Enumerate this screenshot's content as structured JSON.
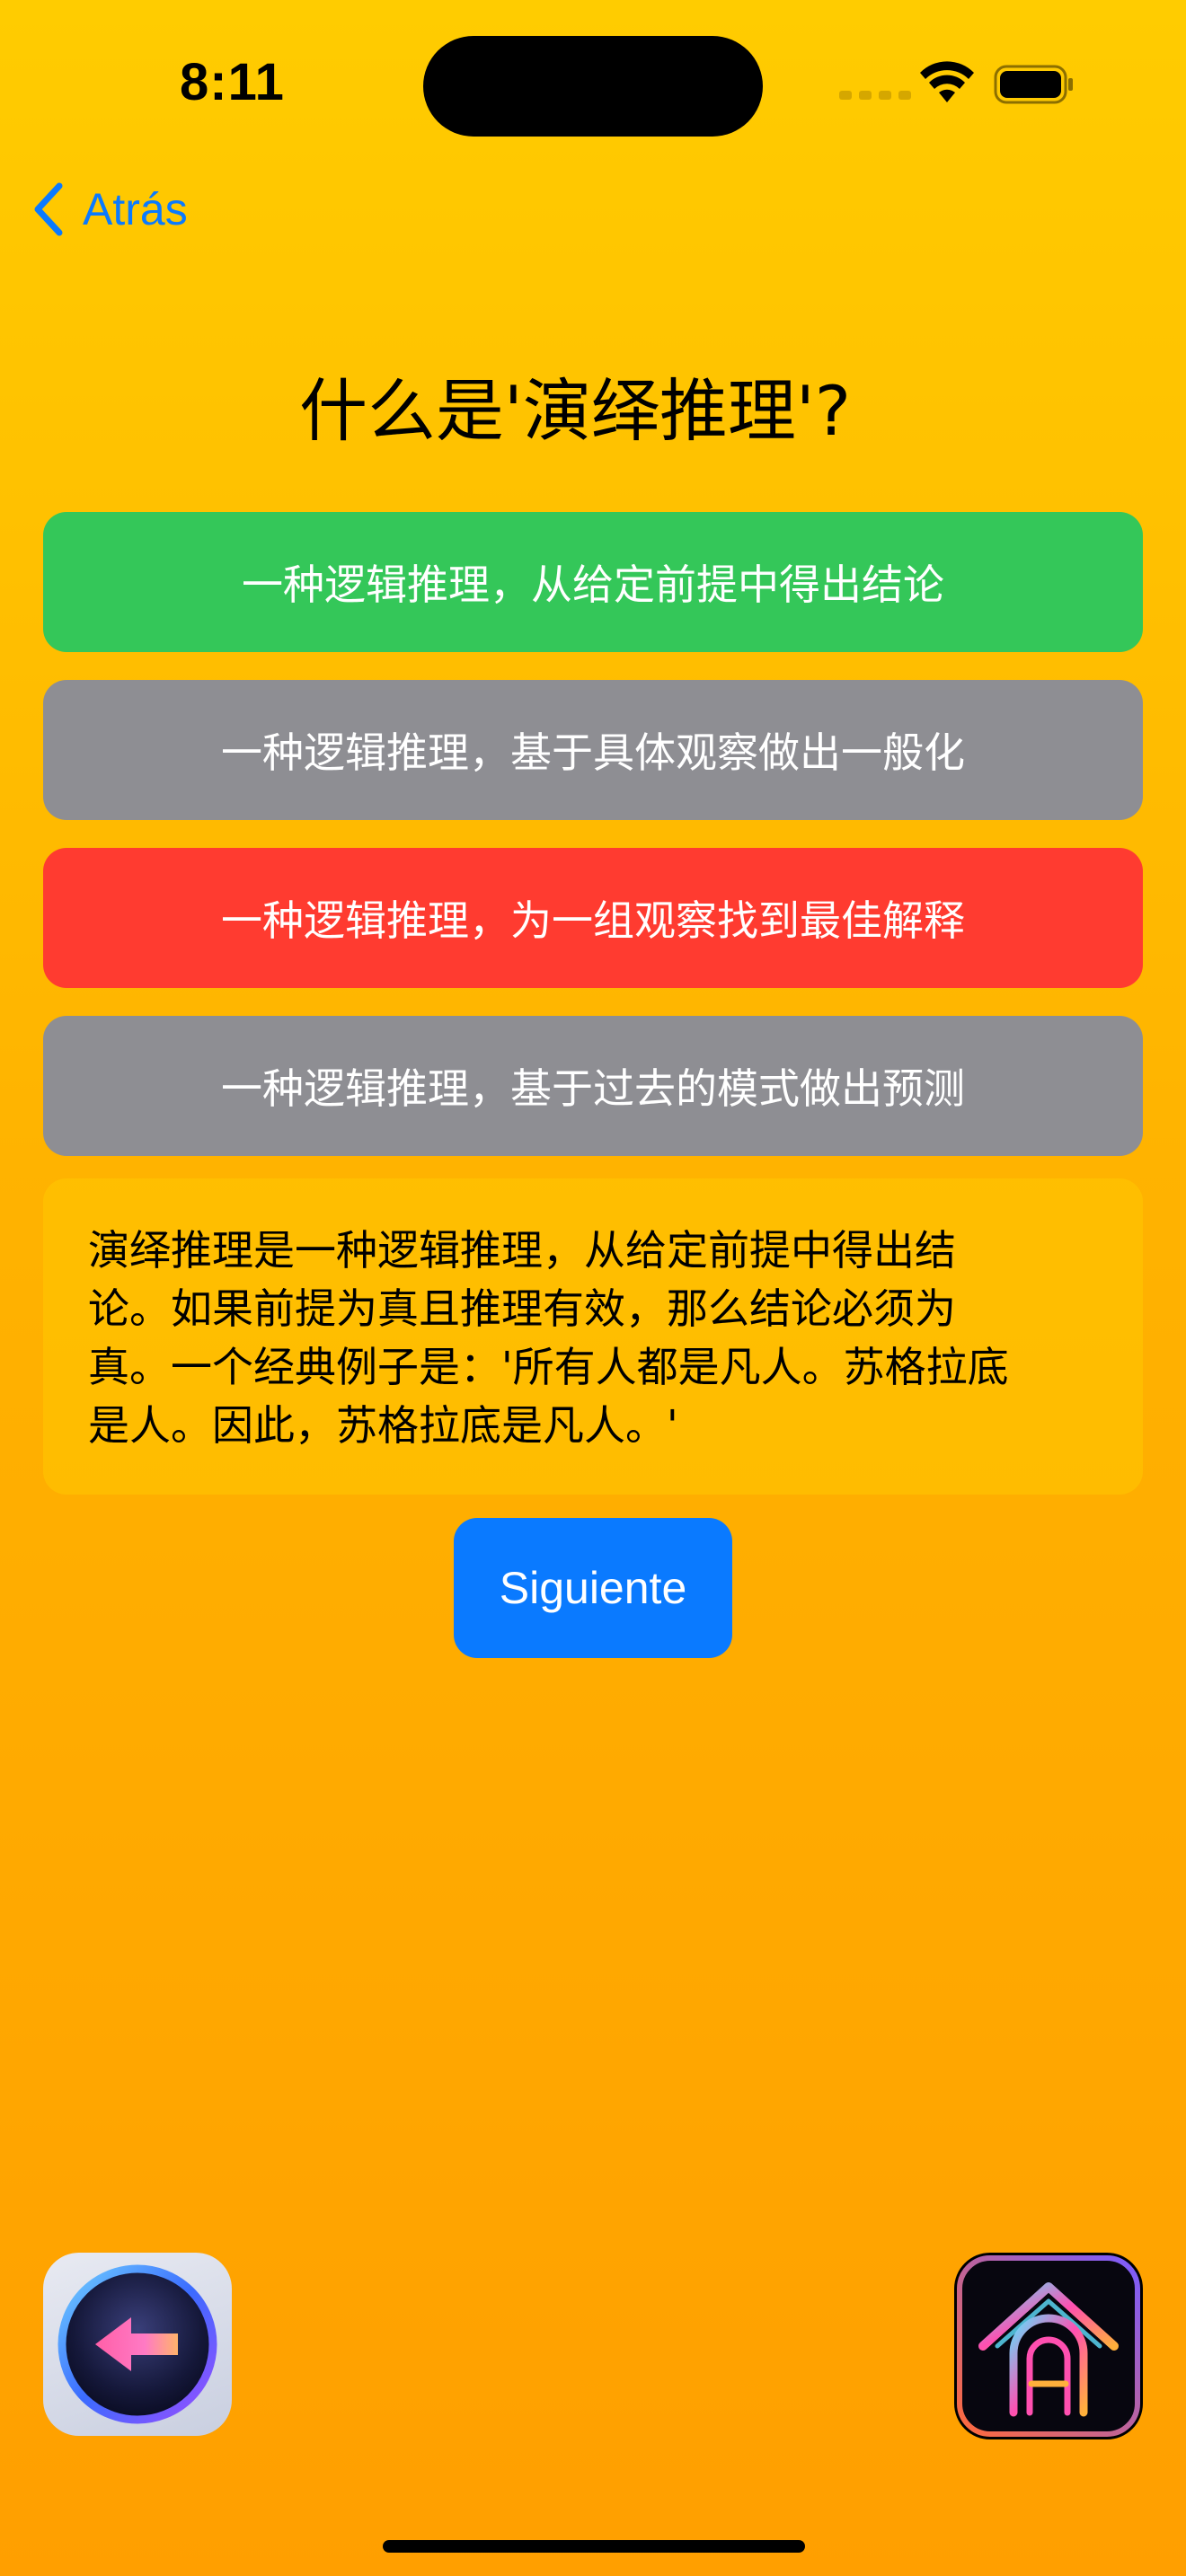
{
  "status_bar": {
    "time": "8:11"
  },
  "nav": {
    "back_label": "Atrás",
    "back_icon": "chevron-left-icon"
  },
  "question": {
    "title": "什么是'演绎推理'?"
  },
  "options": [
    {
      "label": "一种逻辑推理，从给定前提中得出结论",
      "state": "correct",
      "color": "#34C759"
    },
    {
      "label": "一种逻辑推理，基于具体观察做出一般化",
      "state": "neutral",
      "color": "#8E8E93"
    },
    {
      "label": "一种逻辑推理，为一组观察找到最佳解释",
      "state": "wrong",
      "color": "#FF3B30"
    },
    {
      "label": "一种逻辑推理，基于过去的模式做出预测",
      "state": "neutral",
      "color": "#8E8E93"
    }
  ],
  "explanation": {
    "lines": [
      "演绎推理是一种逻辑推理，从给定前提中得出结",
      "论。如果前提为真且推理有效，那么结论必须为",
      "真。一个经典例子是：'所有人都是凡人。苏格拉底",
      "是人。因此，苏格拉底是凡人。'"
    ]
  },
  "next_button": {
    "label": "Siguiente",
    "color": "#0A7AFF"
  },
  "bottom_icons": {
    "left": "back-arrow-app-icon",
    "right": "neon-home-app-icon"
  },
  "colors": {
    "accent": "#0A7AFF",
    "background_top": "#FFCC00",
    "background_bottom": "#FF9F00"
  }
}
